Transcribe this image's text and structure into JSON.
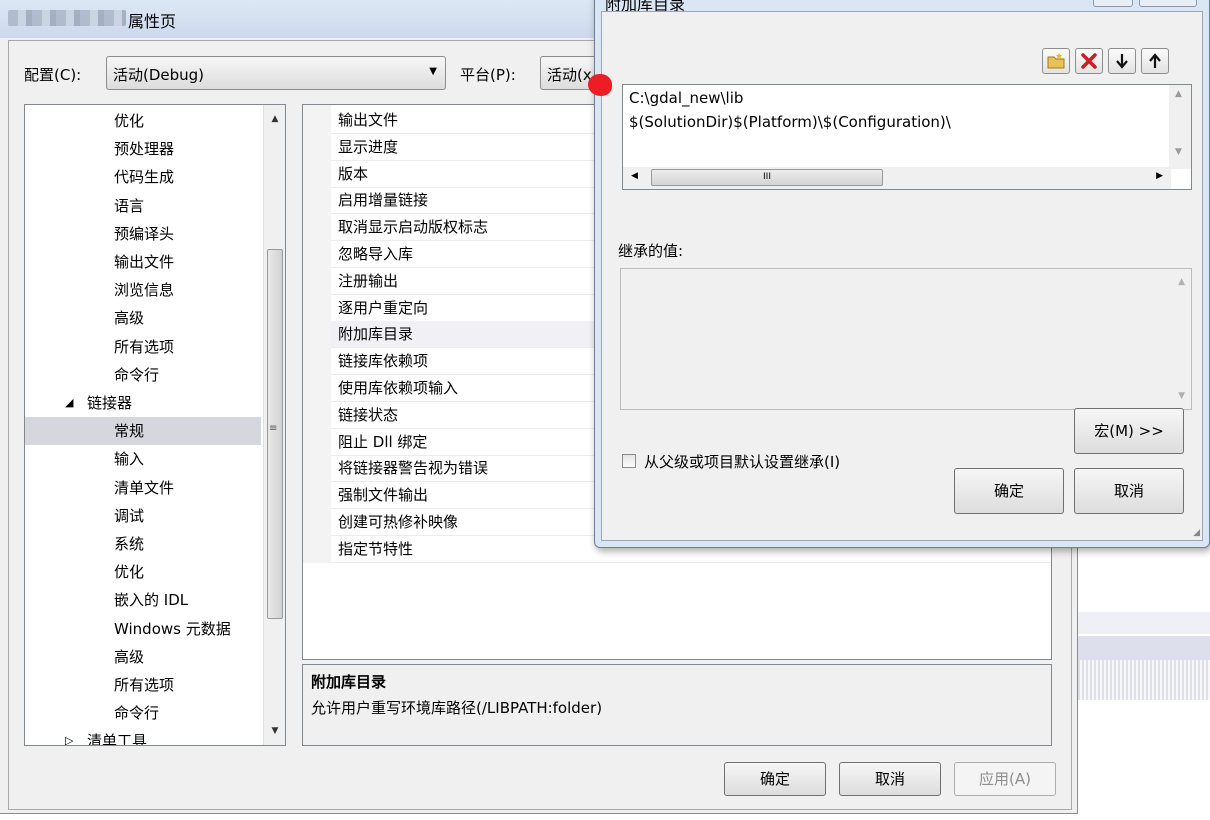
{
  "window": {
    "title": "属性页"
  },
  "config": {
    "config_label": "配置(C):",
    "config_value": "活动(Debug)",
    "platform_label": "平台(P):",
    "platform_value": "活动(x"
  },
  "tree": {
    "items": [
      {
        "label": "优化",
        "level": 2
      },
      {
        "label": "预处理器",
        "level": 2
      },
      {
        "label": "代码生成",
        "level": 2
      },
      {
        "label": "语言",
        "level": 2
      },
      {
        "label": "预编译头",
        "level": 2
      },
      {
        "label": "输出文件",
        "level": 2
      },
      {
        "label": "浏览信息",
        "level": 2
      },
      {
        "label": "高级",
        "level": 2
      },
      {
        "label": "所有选项",
        "level": 2
      },
      {
        "label": "命令行",
        "level": 2
      },
      {
        "label": "链接器",
        "level": 1,
        "expanded": true
      },
      {
        "label": "常规",
        "level": 2,
        "selected": true
      },
      {
        "label": "输入",
        "level": 2
      },
      {
        "label": "清单文件",
        "level": 2
      },
      {
        "label": "调试",
        "level": 2
      },
      {
        "label": "系统",
        "level": 2
      },
      {
        "label": "优化",
        "level": 2
      },
      {
        "label": "嵌入的 IDL",
        "level": 2
      },
      {
        "label": "Windows 元数据",
        "level": 2
      },
      {
        "label": "高级",
        "level": 2
      },
      {
        "label": "所有选项",
        "level": 2
      },
      {
        "label": "命令行",
        "level": 2
      },
      {
        "label": "清单工具",
        "level": 1,
        "expanded": false
      }
    ]
  },
  "grid": {
    "rows": [
      "输出文件",
      "显示进度",
      "版本",
      "启用增量链接",
      "取消显示启动版权标志",
      "忽略导入库",
      "注册输出",
      "逐用户重定向",
      "附加库目录",
      "链接库依赖项",
      "使用库依赖项输入",
      "链接状态",
      "阻止 Dll 绑定",
      "将链接器警告视为错误",
      "强制文件输出",
      "创建可热修补映像",
      "指定节特性"
    ],
    "highlighted_index": 8
  },
  "description": {
    "title": "附加库目录",
    "text": "允许用户重写环境库路径(/LIBPATH:folder)"
  },
  "footer": {
    "ok": "确定",
    "cancel": "取消",
    "apply": "应用(A)"
  },
  "dialog": {
    "title": "附加库目录",
    "lines": [
      "C:\\gdal_new\\lib",
      "$(SolutionDir)$(Platform)\\$(Configuration)\\"
    ],
    "inherited_label": "继承的值:",
    "inherit_checkbox": "从父级或项目默认设置继承(I)",
    "macro_button": "宏(M) >>",
    "ok": "确定",
    "cancel": "取消",
    "toolbar": [
      "new-folder-icon",
      "delete-icon",
      "move-down-icon",
      "move-up-icon"
    ],
    "scroll_glyph": "III"
  },
  "colors": {
    "delete_red": "#cc1e1e",
    "annotation_red": "#ee1c24",
    "selection": "#d6d6df"
  }
}
